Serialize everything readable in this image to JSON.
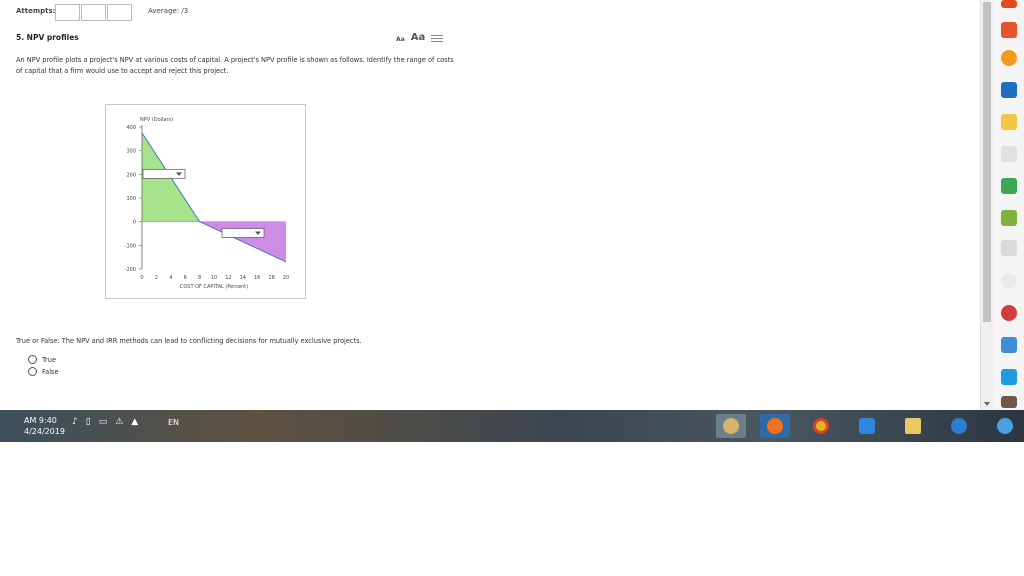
{
  "header": {
    "attempts_label": "Attempts:",
    "average_label": "Average:",
    "average_value": "/3"
  },
  "question": {
    "title": "5. NPV profiles",
    "font_small": "Aa",
    "font_large": "Aa",
    "text": "An NPV profile plots a project's NPV at various costs of capital. A project's NPV profile is shown as follows. Identify the range of costs of capital that a firm would use to accept and reject this project."
  },
  "chart_data": {
    "type": "line",
    "ylabel": "NPV (Dollars)",
    "xlabel": "COST OF CAPITAL (Percent)",
    "x_ticks": [
      "0",
      "2",
      "4",
      "6",
      "8",
      "10",
      "12",
      "14",
      "16",
      "18",
      "20"
    ],
    "y_ticks": [
      "400",
      "300",
      "200",
      "100",
      "0",
      "-100",
      "-200"
    ],
    "xlim": [
      0,
      20
    ],
    "ylim": [
      -200,
      400
    ],
    "series": [
      {
        "x": [
          0,
          8,
          20
        ],
        "y": [
          375,
          0,
          -170
        ]
      }
    ],
    "fill_positive_color": "#a6e38a",
    "fill_negative_color": "#cf8be8",
    "line_color": "#3a6fb5",
    "dropdowns": [
      {
        "value": ""
      },
      {
        "value": ""
      }
    ]
  },
  "true_false": {
    "prompt": "True or False: The NPV and IRR methods can lead to conflicting decisions for mutually exclusive projects.",
    "options": [
      "True",
      "False"
    ]
  },
  "taskbar": {
    "time": "AM 9:40",
    "date": "4/24/2019",
    "language": "EN"
  },
  "colors": {
    "taskbar_accent": "#3c4f5c"
  }
}
